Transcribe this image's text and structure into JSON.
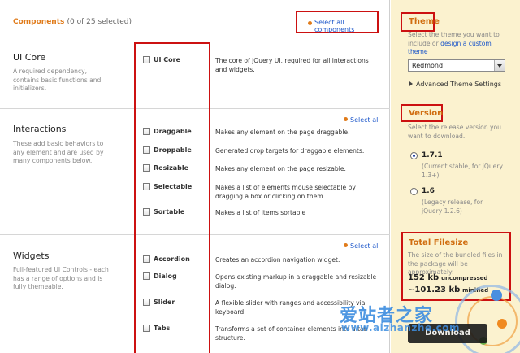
{
  "header": {
    "title": "Components",
    "count": "(0 of 25 selected)",
    "select_all_components": "Select all components"
  },
  "groups": {
    "ui_core": {
      "title": "UI Core",
      "desc": "A required dependency, contains basic functions and initializers.",
      "components": [
        {
          "name": "UI Core",
          "desc": "The core of jQuery UI, required for all interactions and widgets."
        }
      ]
    },
    "interactions": {
      "title": "Interactions",
      "desc": "These add basic behaviors to any element and are used by many components below.",
      "select_all": "Select all",
      "components": [
        {
          "name": "Draggable",
          "desc": "Makes any element on the page draggable."
        },
        {
          "name": "Droppable",
          "desc": "Generated drop targets for draggable elements."
        },
        {
          "name": "Resizable",
          "desc": "Makes any element on the page resizable."
        },
        {
          "name": "Selectable",
          "desc": "Makes a list of elements mouse selectable by dragging a box or clicking on them."
        },
        {
          "name": "Sortable",
          "desc": "Makes a list of items sortable"
        }
      ]
    },
    "widgets": {
      "title": "Widgets",
      "desc": "Full-featured UI Controls - each has a range of options and is fully themeable.",
      "select_all": "Select all",
      "components": [
        {
          "name": "Accordion",
          "desc": "Creates an accordion navigation widget."
        },
        {
          "name": "Dialog",
          "desc": "Opens existing markup in a draggable and resizable dialog."
        },
        {
          "name": "Slider",
          "desc": "A flexible slider with ranges and accessibility via keyboard."
        },
        {
          "name": "Tabs",
          "desc": "Transforms a set of container elements into a tab structure."
        }
      ]
    }
  },
  "sidebar": {
    "theme": {
      "title": "Theme",
      "text": "Select the theme you want to include or",
      "link": "design a custom theme",
      "selected": "Redmond",
      "advanced": "Advanced Theme Settings"
    },
    "version": {
      "title": "Version",
      "text": "Select the release version you want to download.",
      "options": [
        {
          "label": "1.7.1",
          "desc": "(Current stable, for jQuery 1.3+)",
          "selected": true
        },
        {
          "label": "1.6",
          "desc": "(Legacy release, for jQuery 1.2.6)",
          "selected": false
        }
      ]
    },
    "filesize": {
      "title": "Total Filesize",
      "text": "The size of the bundled files in the package will be approximately:",
      "uncompressed_value": "152 kb",
      "uncompressed_label": "uncompressed",
      "minified_value": "~101.23 kb",
      "minified_label": "minified"
    }
  },
  "watermark": {
    "cn": "爱站者之家",
    "url": "www.aizhanzhe.com",
    "button": "Download"
  }
}
